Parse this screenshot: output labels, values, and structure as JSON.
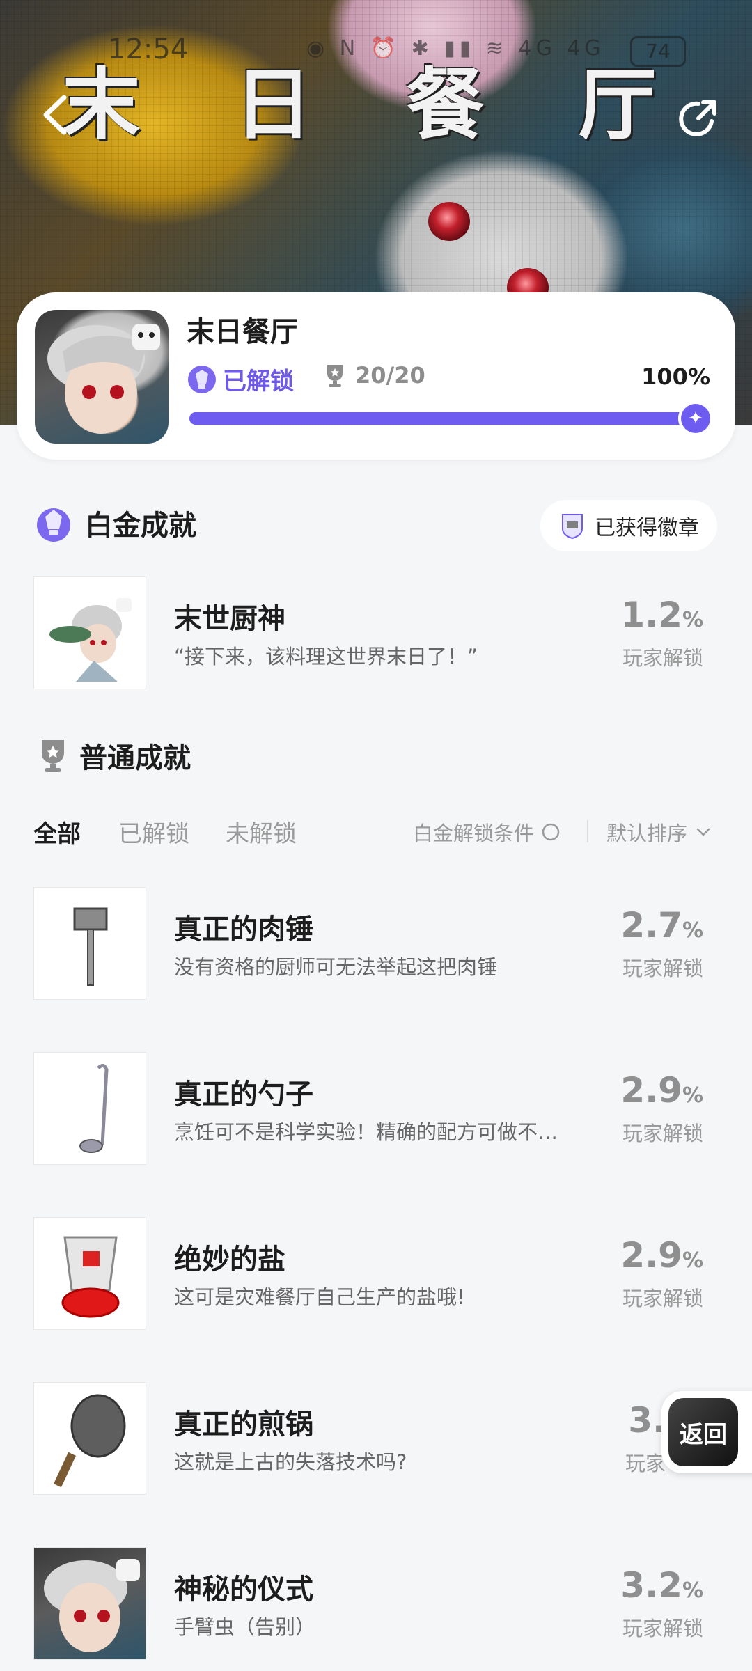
{
  "status_bar": {
    "time": "12:54",
    "icons": "◉ N ⏰ ✱ ▮▮ ≋ 4G 4G",
    "battery": "74"
  },
  "header": {
    "title": "末 日 餐 厅"
  },
  "game": {
    "name": "末日餐厅",
    "unlocked_label": "已解锁",
    "trophies": "20/20",
    "percent_text": "100%",
    "progress": 1.0
  },
  "platinum": {
    "section_title": "白金成就",
    "badge_label": "已获得徽章",
    "item": {
      "title": "末世厨神",
      "desc": "“接下来，该料理这世界末日了！”",
      "percent": "1.2",
      "unit": "%",
      "sub": "玩家解锁"
    }
  },
  "normal": {
    "section_title": "普通成就",
    "tabs": [
      "全部",
      "已解锁",
      "未解锁"
    ],
    "filter_condition": "白金解锁条件",
    "sort_label": "默认排序",
    "items": [
      {
        "title": "真正的肉锤",
        "desc": "没有资格的厨师可无法举起这把肉锤",
        "percent": "2.7",
        "unit": "%",
        "sub": "玩家解锁",
        "icon": "meat-hammer"
      },
      {
        "title": "真正的勺子",
        "desc": "烹饪可不是科学实验！精确的配方可做不…",
        "percent": "2.9",
        "unit": "%",
        "sub": "玩家解锁",
        "icon": "ladle"
      },
      {
        "title": "绝妙的盐",
        "desc": "这可是灾难餐厅自己生产的盐哦!",
        "percent": "2.9",
        "unit": "%",
        "sub": "玩家解锁",
        "icon": "salt-shaker"
      },
      {
        "title": "真正的煎锅",
        "desc": "这就是上古的失落技术吗?",
        "percent": "3.",
        "unit": "",
        "sub": "玩家",
        "icon": "frying-pan"
      },
      {
        "title": "神秘的仪式",
        "desc": "手臂虫（告别）",
        "percent": "3.2",
        "unit": "%",
        "sub": "玩家解锁",
        "icon": "character-portrait"
      }
    ]
  },
  "float_button": {
    "label": "返回"
  },
  "colors": {
    "accent": "#6e5cf0",
    "background": "#f5f6f8"
  }
}
